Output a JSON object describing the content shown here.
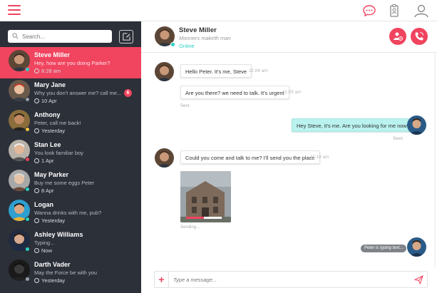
{
  "topbar": {
    "menu_icon": "hamburger-menu-icon",
    "icons": [
      "chat-bubble-icon",
      "id-badge-icon",
      "user-profile-icon"
    ],
    "accent": "#f0445f"
  },
  "search": {
    "placeholder": "Search..."
  },
  "contacts": [
    {
      "name": "Steve Miller",
      "message": "Hey, how are you doing Parker?",
      "time": "8:28 am",
      "status": "online",
      "active": true,
      "unread": ""
    },
    {
      "name": "Mary Jane",
      "message": "Why you don't answer me? call me...",
      "time": "10 Apr",
      "status": "offline",
      "active": false,
      "unread": "6"
    },
    {
      "name": "Anthony",
      "message": "Peter, call me back!",
      "time": "Yesterday",
      "status": "away",
      "active": false,
      "unread": ""
    },
    {
      "name": "Stan Lee",
      "message": "You look familiar boy",
      "time": "1 Apr",
      "status": "busy",
      "active": false,
      "unread": ""
    },
    {
      "name": "May Parker",
      "message": "Buy me some eggs Peter",
      "time": "8 Apr",
      "status": "online",
      "active": false,
      "unread": ""
    },
    {
      "name": "Logan",
      "message": "Wanna drinks with me, pub?",
      "time": "Yesterday",
      "status": "online",
      "active": false,
      "unread": ""
    },
    {
      "name": "Ashley Williams",
      "message": "Typing...",
      "time": "Now",
      "status": "online",
      "active": false,
      "unread": ""
    },
    {
      "name": "Darth Vader",
      "message": "May the Force be with you",
      "time": "Yesterday",
      "status": "offline",
      "active": false,
      "unread": ""
    }
  ],
  "status_colors": {
    "online": "#2ad1c3",
    "away": "#f5c542",
    "busy": "#f0445f",
    "offline": "#9aa0aa"
  },
  "chat": {
    "name": "Steve Miller",
    "subtitle": "Monners maketh man",
    "status": "Online",
    "actions": [
      "remove-user-icon",
      "phone-call-icon"
    ]
  },
  "messages": [
    {
      "dir": "in",
      "text": "Hello Peter. It's me, Steve",
      "time": "11:04 am"
    },
    {
      "dir": "in",
      "text": "Are you there? we need to talk. It's urgent",
      "time": "11:05 am",
      "status": "Sent"
    },
    {
      "dir": "out",
      "text": "Hey Steve, it's me. Are you looking for me now?",
      "status": "Seen"
    },
    {
      "dir": "in",
      "text": "Could you come and talk to me? I'll send you the place",
      "time": "11:16 am"
    },
    {
      "dir": "in",
      "type": "image",
      "status": "Sending...",
      "progress": 0.5
    }
  ],
  "typing": "Peter is typing text...",
  "composer": {
    "placeholder": "Type a message..."
  }
}
